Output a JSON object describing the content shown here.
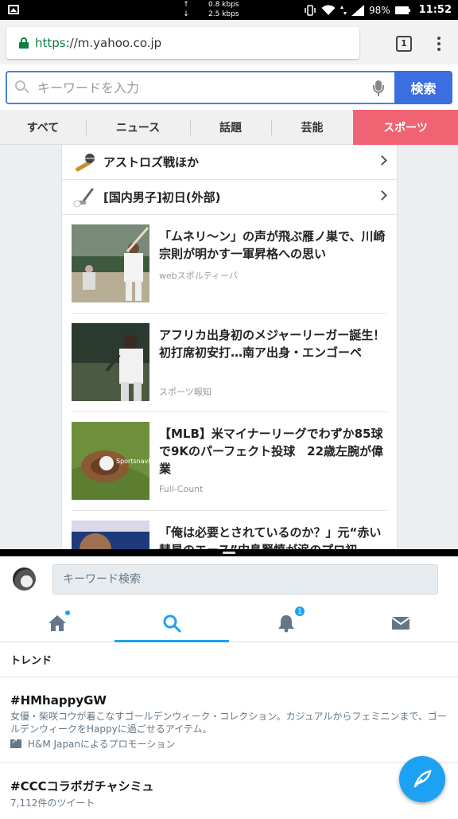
{
  "status_bar": {
    "net_up": "0.8 kbps",
    "net_down": "2.5 kbps",
    "battery": "98%",
    "time": "11:52"
  },
  "browser": {
    "url_scheme": "https",
    "url_rest": "://m.yahoo.co.jp",
    "tab_count": "1"
  },
  "yahoo": {
    "search_placeholder": "キーワードを入力",
    "search_button": "検索",
    "categories": [
      {
        "label": "すべて",
        "active": false
      },
      {
        "label": "ニュース",
        "active": false
      },
      {
        "label": "話題",
        "active": false
      },
      {
        "label": "芸能",
        "active": false
      },
      {
        "label": "スポーツ",
        "active": true
      }
    ],
    "links": [
      {
        "label": "アストロズ戦ほか",
        "icon": "baseball-icon"
      },
      {
        "label": "[国内男子]初日(外部)",
        "icon": "golf-icon"
      }
    ],
    "news": [
      {
        "title": "「ムネリ〜ン」の声が飛ぶ雁ノ巣で、川崎宗則が明かす一軍昇格への思い",
        "source": "webスポルティーバ"
      },
      {
        "title": "アフリカ出身初のメジャーリーガー誕生！　初打席初安打…南ア出身・エンゴーペ",
        "source": "スポーツ報知"
      },
      {
        "title": "【MLB】米マイナーリーグでわずか85球で9Kのパーフェクト投球　22歳左腕が偉業",
        "source": "Full-Count",
        "thumb_overlay": "Sportsnavi"
      },
      {
        "title": "「俺は必要とされているのか？」元“赤い彗星のエース”中島賢慎が涙のプロ初",
        "source": ""
      }
    ]
  },
  "twitter": {
    "search_placeholder": "キーワード検索",
    "notification_badge": "1",
    "trends_header": "トレンド",
    "trends": [
      {
        "tag": "#HMhappyGW",
        "desc": "女優・柴咲コウが着こなすゴールデンウィーク・コレクション。カジュアルからフェミニンまで、ゴールデンウィークをHappyに過ごせるアイテム。",
        "promo": "H&M Japanによるプロモーション"
      },
      {
        "tag": "#CCCコラボガチャシミュ",
        "count": "7,112件のツイート"
      }
    ]
  },
  "colors": {
    "sports_tab": "#f06373",
    "yahoo_blue": "#3b6fe0",
    "twitter_blue": "#1da1f2",
    "secure_green": "#0b8043"
  }
}
